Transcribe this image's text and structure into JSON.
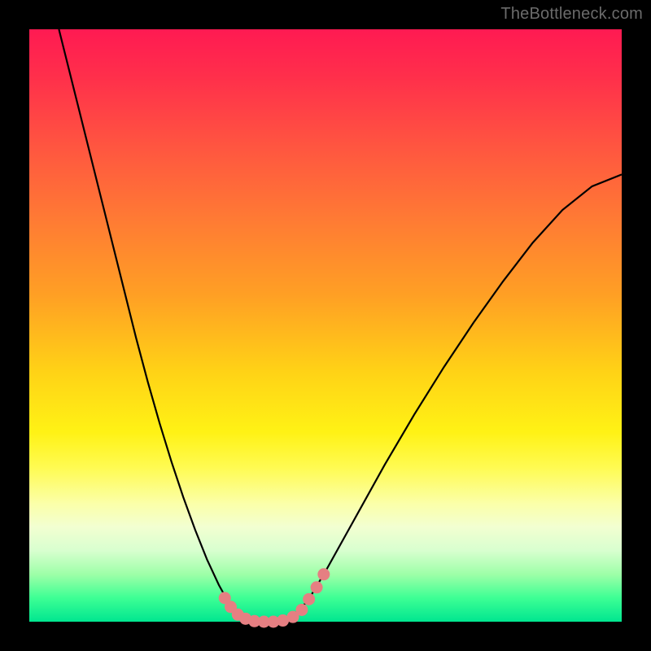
{
  "watermark": {
    "text": "TheBottleneck.com"
  },
  "colors": {
    "frame": "#000000",
    "curve_stroke": "#000000",
    "marker_fill": "#e57f82",
    "gradient_top": "#ff1a52",
    "gradient_bottom": "#00e690"
  },
  "chart_data": {
    "type": "line",
    "title": "",
    "xlabel": "",
    "ylabel": "",
    "xlim": [
      0,
      1
    ],
    "ylim": [
      0,
      1
    ],
    "grid": false,
    "legend": false,
    "series": [
      {
        "name": "bottleneck-curve",
        "x": [
          0.05,
          0.06,
          0.08,
          0.1,
          0.12,
          0.14,
          0.16,
          0.18,
          0.2,
          0.22,
          0.24,
          0.26,
          0.28,
          0.3,
          0.32,
          0.335,
          0.35,
          0.37,
          0.4,
          0.43,
          0.45,
          0.47,
          0.5,
          0.55,
          0.6,
          0.65,
          0.7,
          0.75,
          0.8,
          0.85,
          0.9,
          0.95,
          1.0
        ],
        "y": [
          1.0,
          0.96,
          0.88,
          0.8,
          0.72,
          0.64,
          0.56,
          0.48,
          0.405,
          0.335,
          0.27,
          0.21,
          0.155,
          0.105,
          0.062,
          0.035,
          0.015,
          0.004,
          0.0,
          0.004,
          0.015,
          0.035,
          0.085,
          0.175,
          0.265,
          0.35,
          0.43,
          0.505,
          0.575,
          0.64,
          0.695,
          0.735,
          0.755
        ]
      }
    ],
    "markers": {
      "name": "bottom-markers",
      "points": [
        {
          "x": 0.33,
          "y": 0.04
        },
        {
          "x": 0.34,
          "y": 0.025
        },
        {
          "x": 0.352,
          "y": 0.012
        },
        {
          "x": 0.365,
          "y": 0.005
        },
        {
          "x": 0.38,
          "y": 0.001
        },
        {
          "x": 0.396,
          "y": 0.0
        },
        {
          "x": 0.412,
          "y": 0.0
        },
        {
          "x": 0.428,
          "y": 0.002
        },
        {
          "x": 0.445,
          "y": 0.008
        },
        {
          "x": 0.46,
          "y": 0.02
        },
        {
          "x": 0.472,
          "y": 0.038
        },
        {
          "x": 0.485,
          "y": 0.058
        },
        {
          "x": 0.497,
          "y": 0.08
        }
      ]
    }
  }
}
